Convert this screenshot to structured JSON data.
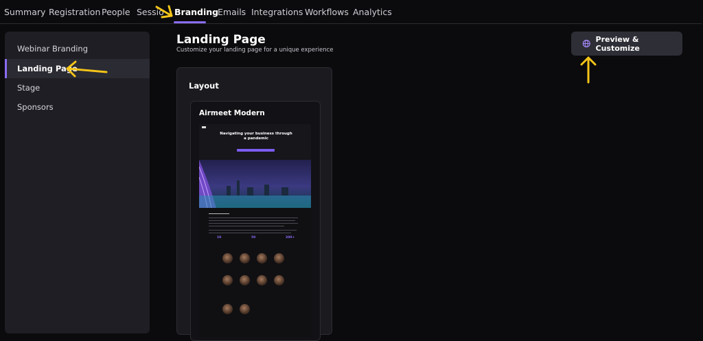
{
  "nav": {
    "tabs": [
      {
        "label": "Summary"
      },
      {
        "label": "Registration"
      },
      {
        "label": "People"
      },
      {
        "label": "Session"
      },
      {
        "label": "Branding"
      },
      {
        "label": "Emails"
      },
      {
        "label": "Integrations"
      },
      {
        "label": "Workflows"
      },
      {
        "label": "Analytics"
      }
    ],
    "active_tab": "Branding"
  },
  "sidebar": {
    "items": [
      {
        "label": "Webinar Branding"
      },
      {
        "label": "Landing Page"
      },
      {
        "label": "Stage"
      },
      {
        "label": "Sponsors"
      }
    ],
    "active_item": "Landing Page"
  },
  "header": {
    "title": "Landing Page",
    "subtitle": "Customize your landing page for a unique experience",
    "preview_button": "Preview & Customize"
  },
  "layout": {
    "section_title": "Layout",
    "theme_name": "Airmeet Modern",
    "thumbnail_headline": "Navigating your business through a pandemic",
    "thumbnail_stats": [
      "10",
      "50",
      "200+"
    ]
  },
  "colors": {
    "accent": "#8b6cf6",
    "annotation": "#f5c518",
    "background": "#0b0b0d"
  }
}
